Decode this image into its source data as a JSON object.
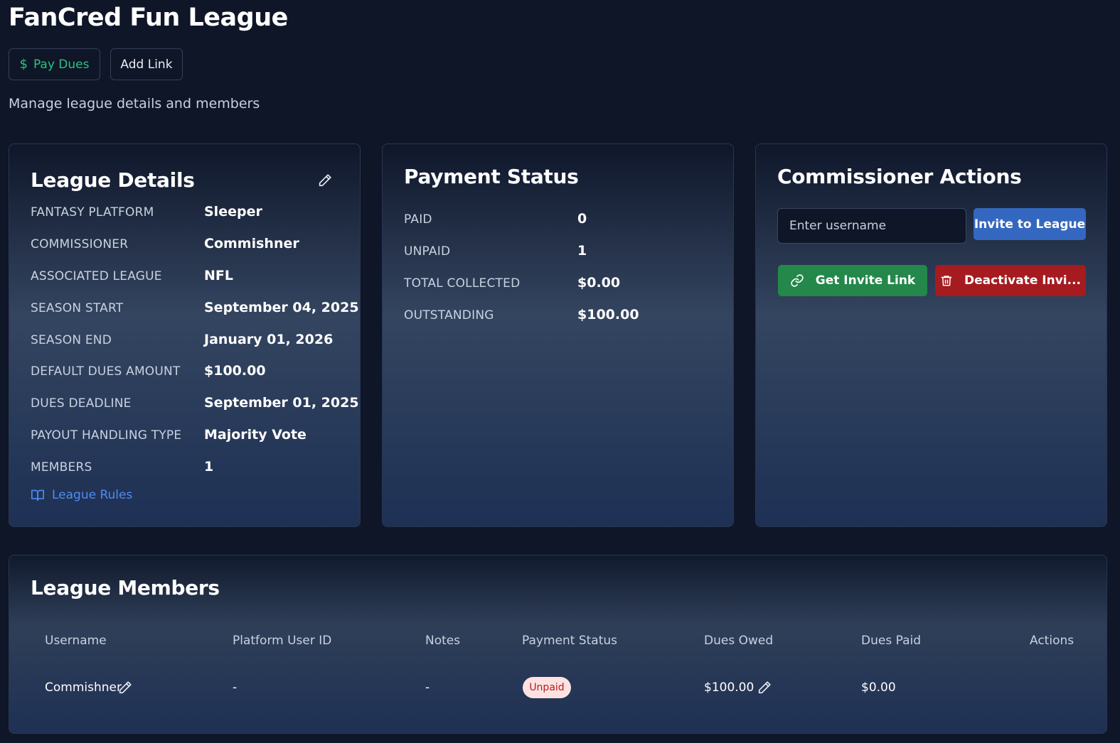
{
  "league": {
    "title": "FanCred Fun League",
    "subtitle": "Manage league details and members"
  },
  "toolbar": {
    "pay_dues_icon": "$",
    "pay_dues_label": "Pay Dues",
    "add_link_label": "Add Link"
  },
  "details": {
    "title": "League Details",
    "rows": [
      {
        "label": "FANTASY PLATFORM",
        "value": "Sleeper"
      },
      {
        "label": "COMMISSIONER",
        "value": "Commishner"
      },
      {
        "label": "ASSOCIATED LEAGUE",
        "value": "NFL"
      },
      {
        "label": "SEASON START",
        "value": "September 04, 2025"
      },
      {
        "label": "SEASON END",
        "value": "January 01, 2026"
      },
      {
        "label": "DEFAULT DUES AMOUNT",
        "value": "$100.00"
      },
      {
        "label": "DUES DEADLINE",
        "value": "September 01, 2025"
      },
      {
        "label": "PAYOUT HANDLING TYPE",
        "value": "Majority Vote"
      },
      {
        "label": "MEMBERS",
        "value": "1"
      }
    ],
    "rules_link": "League Rules"
  },
  "payment": {
    "title": "Payment Status",
    "rows": [
      {
        "label": "PAID",
        "value": "0"
      },
      {
        "label": "UNPAID",
        "value": "1"
      },
      {
        "label": "TOTAL COLLECTED",
        "value": "$0.00"
      },
      {
        "label": "OUTSTANDING",
        "value": "$100.00"
      }
    ]
  },
  "commissioner": {
    "title": "Commissioner Actions",
    "username_placeholder": "Enter username",
    "invite_label": "Invite to League",
    "get_link_label": "Get Invite Link",
    "deactivate_label": "Deactivate Invi..."
  },
  "members": {
    "title": "League Members",
    "columns": [
      "Username",
      "Platform User ID",
      "Notes",
      "Payment Status",
      "Dues Owed",
      "Dues Paid",
      "Actions"
    ],
    "rows": [
      {
        "username": "Commishner",
        "platform_user_id": "-",
        "notes": "-",
        "payment_status": "Unpaid",
        "dues_owed": "$100.00",
        "dues_paid": "$0.00"
      }
    ]
  },
  "colors": {
    "background": "#0e1628",
    "accent_green": "#2ec27e",
    "link_blue": "#4f8cf2",
    "invite_blue": "#3468c0",
    "button_green": "#23884a",
    "button_red": "#a51b1f",
    "badge_bg": "#fde2e2",
    "badge_text": "#b91c1c"
  },
  "icons": {
    "pay_dues": "dollar-icon",
    "edit": "pencil-icon",
    "rules": "book-icon",
    "get_link": "link-icon",
    "deactivate": "trash-icon"
  }
}
